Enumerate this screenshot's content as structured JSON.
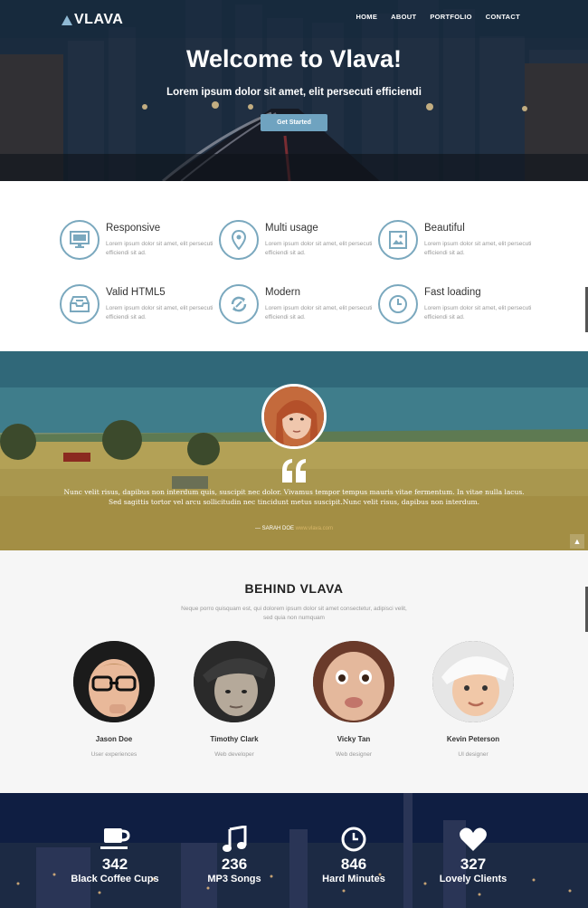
{
  "brand": {
    "name": "VLAVA"
  },
  "nav": {
    "items": [
      "HOME",
      "ABOUT",
      "PORTFOLIO",
      "CONTACT"
    ]
  },
  "hero": {
    "title": "Welcome to Vlava!",
    "subtitle": "Lorem ipsum dolor sit amet, elit persecuti efficiendi",
    "cta": "Get Started"
  },
  "features": [
    {
      "title": "Responsive",
      "icon": "monitor-icon",
      "desc": "Lorem ipsum dolor sit amet, elit persecuti efficiendi sit ad."
    },
    {
      "title": "Multi usage",
      "icon": "map-pin-icon",
      "desc": "Lorem ipsum dolor sit amet, elit persecuti efficiendi sit ad."
    },
    {
      "title": "Beautiful",
      "icon": "image-icon",
      "desc": "Lorem ipsum dolor sit amet, elit persecuti efficiendi sit ad."
    },
    {
      "title": "Valid HTML5",
      "icon": "inbox-icon",
      "desc": "Lorem ipsum dolor sit amet, elit persecuti efficiendi sit ad."
    },
    {
      "title": "Modern",
      "icon": "refresh-icon",
      "desc": "Lorem ipsum dolor sit amet, elit persecuti efficiendi sit ad."
    },
    {
      "title": "Fast loading",
      "icon": "clock-icon",
      "desc": "Lorem ipsum dolor sit amet, elit persecuti efficiendi sit ad."
    }
  ],
  "testimonial": {
    "text": "Nunc velit risus, dapibus non interdum quis, suscipit nec dolor. Vivamus tempor tempus mauris vitae fermentum. In vitae nulla lacus. Sed sagittis tortor vel arcu sollicitudin nec tincidunt metus suscipit.Nunc velit risus, dapibus non interdum.",
    "author": "— SARAH DOE",
    "author_link": "www.vlava.com"
  },
  "team": {
    "heading": "BEHIND VLAVA",
    "intro": "Neque porro quisquam est, qui dolorem ipsum dolor sit amet consectetur, adipisci velit, sed quia non numquam",
    "members": [
      {
        "name": "Jason Doe",
        "role": "User experiences"
      },
      {
        "name": "Timothy Clark",
        "role": "Web developer"
      },
      {
        "name": "Vicky Tan",
        "role": "Web designer"
      },
      {
        "name": "Kevin Peterson",
        "role": "UI designer"
      }
    ]
  },
  "stats": [
    {
      "value": "342",
      "label": "Black Coffee Cups",
      "icon": "coffee-icon"
    },
    {
      "value": "236",
      "label": "MP3 Songs",
      "icon": "music-note-icon"
    },
    {
      "value": "846",
      "label": "Hard Minutes",
      "icon": "clock-icon"
    },
    {
      "value": "327",
      "label": "Lovely Clients",
      "icon": "heart-icon"
    }
  ],
  "colors": {
    "accent": "#6fa3c0",
    "icon_border": "#7aa8be",
    "author_link": "#d8b668"
  }
}
